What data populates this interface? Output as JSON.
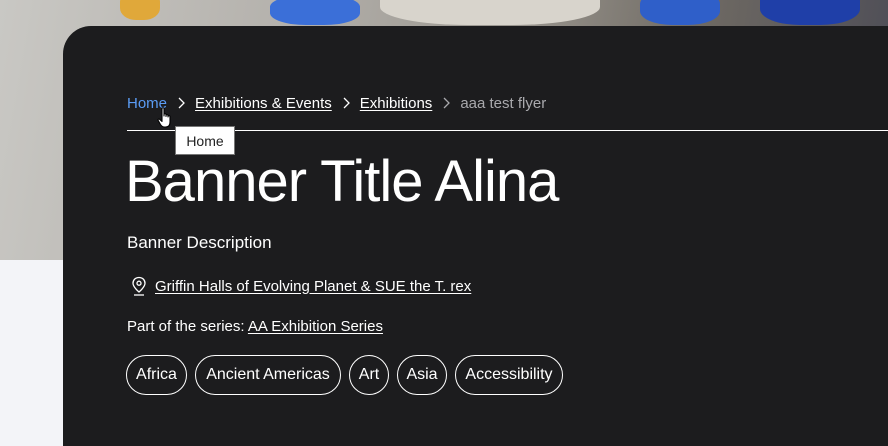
{
  "breadcrumb": {
    "home": "Home",
    "exhibitions_events": "Exhibitions & Events",
    "exhibitions": "Exhibitions",
    "current": "aaa test flyer"
  },
  "tooltip": "Home",
  "banner": {
    "title": "Banner Title Alina",
    "description": "Banner Description",
    "location": "Griffin Halls of Evolving Planet & SUE the T. rex",
    "series_prefix": "Part of the series: ",
    "series_link": "AA Exhibition Series"
  },
  "tags": [
    "Africa",
    "Ancient Americas",
    "Art",
    "Asia",
    "Accessibility"
  ],
  "icons": {
    "separator": "chevron-right-icon",
    "location": "map-pin-icon",
    "cursor": "hand-pointer-icon"
  },
  "colors": {
    "card_background": "#1c1c1e",
    "link_active": "#5b9cf5",
    "text": "#ffffff",
    "muted": "#a9a9ad"
  }
}
